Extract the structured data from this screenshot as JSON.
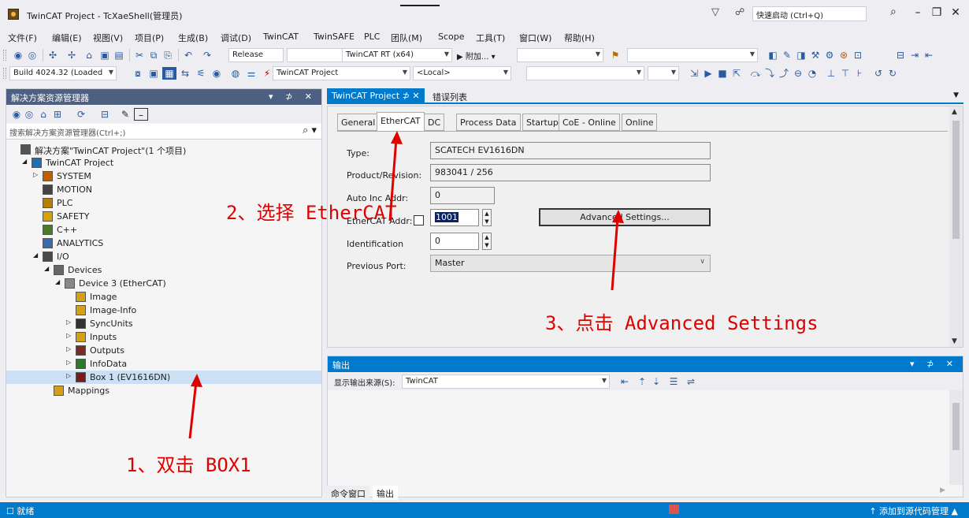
{
  "window": {
    "title": "TwinCAT Project - TcXaeShell(管理员)",
    "quick_launch": "快速启动 (Ctrl+Q)"
  },
  "menu": [
    "文件(F)",
    "编辑(E)",
    "视图(V)",
    "项目(P)",
    "生成(B)",
    "调试(D)",
    "TwinCAT",
    "TwinSAFE",
    "PLC",
    "团队(M)",
    "Scope",
    "工具(T)",
    "窗口(W)",
    "帮助(H)"
  ],
  "toolbar": {
    "config": "Release",
    "platform": "TwinCAT RT (x64)",
    "attach": "附加...",
    "build": "Build 4024.32 (Loaded",
    "project_combo": "TwinCAT Project",
    "target_combo": "<Local>"
  },
  "solution_explorer": {
    "title": "解决方案资源管理器",
    "search_placeholder": "搜索解决方案资源管理器(Ctrl+;)",
    "tree": [
      {
        "label": "解决方案\"TwinCAT Project\"(1 个项目)",
        "indent": 0,
        "exp": "",
        "icon": "solution-icon"
      },
      {
        "label": "TwinCAT Project",
        "indent": 1,
        "exp": "◢",
        "icon": "project-icon"
      },
      {
        "label": "SYSTEM",
        "indent": 2,
        "exp": "▷",
        "icon": "system-icon"
      },
      {
        "label": "MOTION",
        "indent": 2,
        "exp": "",
        "icon": "motion-icon"
      },
      {
        "label": "PLC",
        "indent": 2,
        "exp": "",
        "icon": "plc-icon"
      },
      {
        "label": "SAFETY",
        "indent": 2,
        "exp": "",
        "icon": "safety-icon"
      },
      {
        "label": "C++",
        "indent": 2,
        "exp": "",
        "icon": "cpp-icon"
      },
      {
        "label": "ANALYTICS",
        "indent": 2,
        "exp": "",
        "icon": "analytics-icon"
      },
      {
        "label": "I/O",
        "indent": 2,
        "exp": "◢",
        "icon": "io-icon"
      },
      {
        "label": "Devices",
        "indent": 3,
        "exp": "◢",
        "icon": "devices-icon"
      },
      {
        "label": "Device 3 (EtherCAT)",
        "indent": 4,
        "exp": "◢",
        "icon": "ethercat-device-icon"
      },
      {
        "label": "Image",
        "indent": 5,
        "exp": "",
        "icon": "image-icon"
      },
      {
        "label": "Image-Info",
        "indent": 5,
        "exp": "",
        "icon": "image-info-icon"
      },
      {
        "label": "SyncUnits",
        "indent": 5,
        "exp": "▷",
        "icon": "syncunits-icon"
      },
      {
        "label": "Inputs",
        "indent": 5,
        "exp": "▷",
        "icon": "inputs-icon"
      },
      {
        "label": "Outputs",
        "indent": 5,
        "exp": "▷",
        "icon": "outputs-icon"
      },
      {
        "label": "InfoData",
        "indent": 5,
        "exp": "▷",
        "icon": "infodata-icon"
      },
      {
        "label": "Box 1 (EV1616DN)",
        "indent": 5,
        "exp": "▷",
        "icon": "box-icon",
        "selected": true
      },
      {
        "label": "Mappings",
        "indent": 3,
        "exp": "",
        "icon": "mappings-icon"
      }
    ]
  },
  "doc_tabs": {
    "project": "TwinCAT Project",
    "pin": "⊅",
    "close": "✕",
    "errors": "错误列表"
  },
  "prop_tabs": [
    "General",
    "EtherCAT",
    "DC",
    "Process Data",
    "Startup",
    "CoE - Online",
    "Online"
  ],
  "ethercat": {
    "type_label": "Type:",
    "type_value": "SCATECH EV1616DN",
    "product_label": "Product/Revision:",
    "product_value": "983041 / 256",
    "autoinc_label": "Auto Inc Addr:",
    "autoinc_value": "0",
    "addr_label": "EtherCAT Addr:",
    "addr_value": "1001",
    "ident_label": "Identification",
    "ident_value": "0",
    "prev_label": "Previous Port:",
    "prev_value": "Master",
    "advanced_button": "Advanced Settings..."
  },
  "output": {
    "title": "输出",
    "source_label": "显示输出来源(S):",
    "source_value": "TwinCAT"
  },
  "bottom_tabs": [
    "命令窗口",
    "输出"
  ],
  "status": {
    "text": "就绪",
    "source_control": "↑ 添加到源代码管理 ▲"
  },
  "annotations": {
    "step1": "1、双击 BOX1",
    "step2": "2、选择 EtherCAT",
    "step3": "3、点击 Advanced Settings"
  },
  "colors": {
    "accent": "#007acc",
    "annotation": "#e00000",
    "panel_header": "#4d6082"
  }
}
